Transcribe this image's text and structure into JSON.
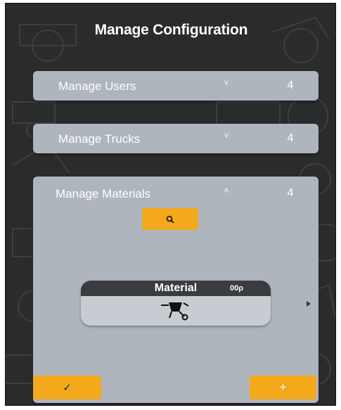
{
  "title": "Manage Configuration",
  "panels": {
    "users": {
      "label": "Manage Users",
      "count": "4",
      "chevron": "˅"
    },
    "trucks": {
      "label": "Manage Trucks",
      "count": "4",
      "chevron": "˅"
    },
    "materials": {
      "label": "Manage Materials",
      "count": "4",
      "chevron": "˄"
    }
  },
  "material_card": {
    "title": "Material",
    "code": "00ρ",
    "icon": "wheelbarrow-icon"
  },
  "buttons": {
    "confirm": "✓",
    "add": "+",
    "search_icon": "search-icon"
  },
  "colors": {
    "background": "#2a2b2d",
    "panel": "#aeb5bd",
    "accent": "#f3a91b",
    "card_header": "#3b3c3f"
  }
}
